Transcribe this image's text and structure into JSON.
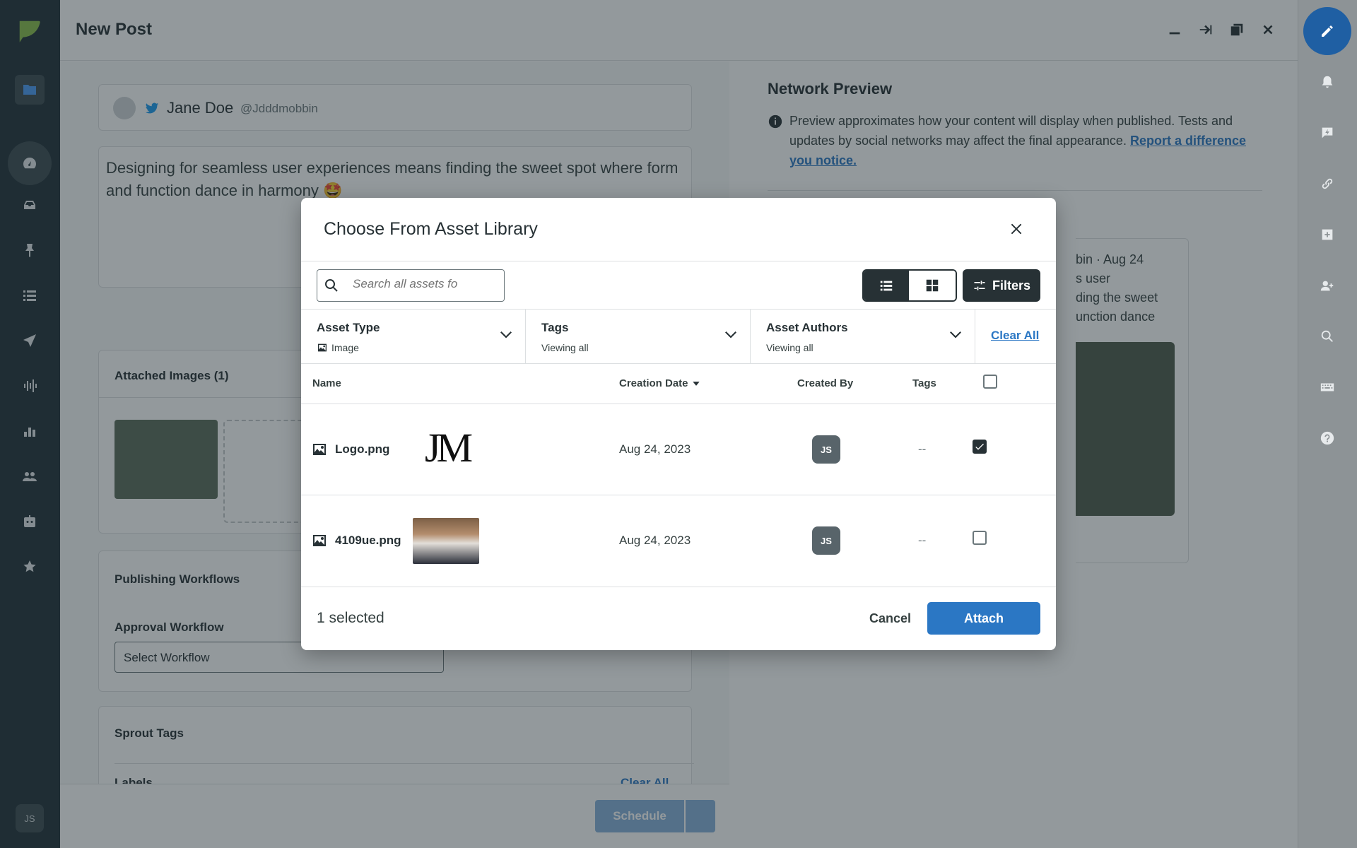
{
  "app": {
    "page_title": "New Post",
    "account": {
      "name": "Jane Doe",
      "handle": "@Jdddmobbin"
    },
    "post_text": "Designing for seamless user experiences means finding the sweet spot where form and function dance in harmony 🤩",
    "avatar_initials": "JS"
  },
  "composer": {
    "attached_images_title": "Attached Images (1)",
    "publishing_workflows_title": "Publishing Workflows",
    "approval_workflow_label": "Approval Workflow",
    "select_workflow_value": "Select Workflow",
    "sprout_tags_title": "Sprout Tags",
    "labels_label": "Labels",
    "clear_all": "Clear All",
    "schedule_label": "Schedule"
  },
  "preview": {
    "title": "Network Preview",
    "note": "Preview approximates how your content will display when published. Tests and updates by social networks may affect the final appearance.",
    "report_link": "Report a difference you notice.",
    "tweet_fragments": [
      "bin · Aug 24",
      "s user",
      "ding the sweet",
      "unction dance"
    ]
  },
  "modal": {
    "title": "Choose From Asset Library",
    "search_placeholder": "Search all assets fo",
    "filters_label": "Filters",
    "filter_asset_type": {
      "label": "Asset Type",
      "value": "Image"
    },
    "filter_tags": {
      "label": "Tags",
      "value": "Viewing all"
    },
    "filter_authors": {
      "label": "Asset Authors",
      "value": "Viewing all"
    },
    "clear_all": "Clear All",
    "columns": {
      "name": "Name",
      "creation_date": "Creation Date",
      "created_by": "Created By",
      "tags": "Tags"
    },
    "rows": [
      {
        "name": "Logo.png",
        "date": "Aug 24, 2023",
        "author": "JS",
        "tags": "--",
        "checked": true
      },
      {
        "name": "4109ue.png",
        "date": "Aug 24, 2023",
        "author": "JS",
        "tags": "--",
        "checked": false
      }
    ],
    "selected_count": "1 selected",
    "cancel_label": "Cancel",
    "attach_label": "Attach",
    "logo_text": "JM"
  },
  "colors": {
    "nav_bg": "#213038",
    "accent": "#2b77c4",
    "attach_bg": "#2b77c4",
    "filters_bg": "#273135"
  }
}
